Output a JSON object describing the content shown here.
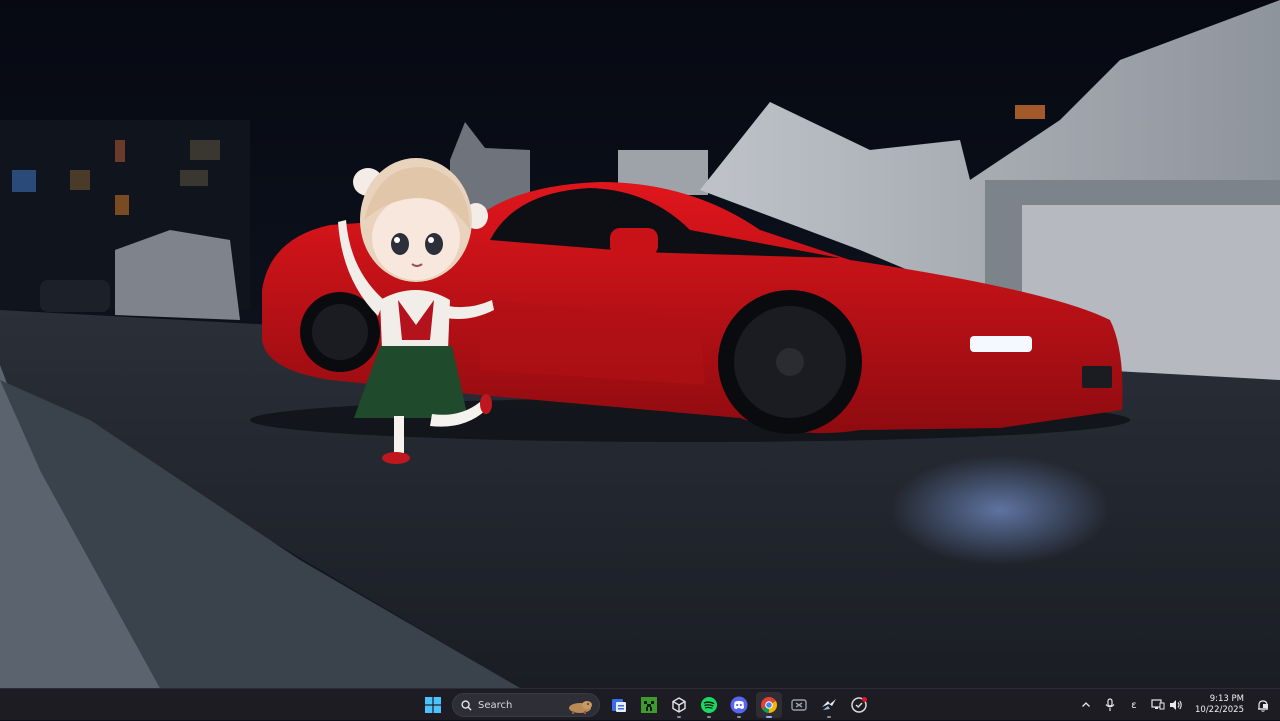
{
  "desktop": {
    "wallpaper": "night-street-red-sports-car",
    "mascot": "chibi-anime-girl-desktop-pet"
  },
  "taskbar": {
    "start_icon": "windows-start-icon",
    "search": {
      "placeholder": "Search",
      "icon": "search-icon",
      "decoration": "capybara-search-highlight"
    },
    "apps": [
      {
        "name": "file-explorer-icon",
        "active": false,
        "running": false
      },
      {
        "name": "minecraft-icon",
        "active": false,
        "running": false
      },
      {
        "name": "cube-app-icon",
        "active": false,
        "running": true
      },
      {
        "name": "spotify-icon",
        "active": false,
        "running": true
      },
      {
        "name": "discord-icon",
        "active": false,
        "running": true
      },
      {
        "name": "chrome-icon",
        "active": true,
        "running": true
      },
      {
        "name": "xbox-icon",
        "active": false,
        "running": false
      },
      {
        "name": "steam-icon",
        "active": false,
        "running": true
      },
      {
        "name": "game-overlay-icon",
        "active": false,
        "running": false,
        "badge": true
      }
    ],
    "tray": {
      "overflow_icon": "chevron-up-icon",
      "mic_icon": "microphone-icon",
      "language": "ε",
      "network_icon": "network-icon",
      "volume_icon": "volume-icon",
      "time": "9:13 PM",
      "date": "10/22/2025",
      "notification_icon": "notification-bell-icon"
    },
    "colors": {
      "background": "#1c1c22",
      "accent": "#9aa8ff"
    }
  }
}
